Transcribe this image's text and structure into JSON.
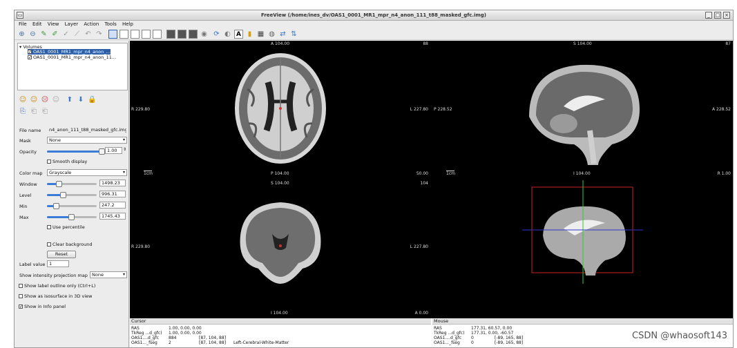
{
  "window": {
    "title": "FreeView (/home/ines_dv/OAS1_0001_MR1_mpr_n4_anon_111_t88_masked_gfc.img)",
    "controls": [
      "_",
      "□",
      "×"
    ]
  },
  "menu": [
    "File",
    "Edit",
    "View",
    "Layer",
    "Action",
    "Tools",
    "Help"
  ],
  "layers": {
    "group_label": "Volumes",
    "items": [
      {
        "label": "OAS1_0001_MR1_mpr_n4_anon_...",
        "checked": true,
        "selected": true
      },
      {
        "label": "OAS1_0001_MR1_mpr_n4_anon_11...",
        "checked": true,
        "selected": false
      }
    ]
  },
  "props": {
    "file_name_label": "File name",
    "file_name_value": "n4_anon_111_t88_masked_gfc.img",
    "mask_label": "Mask",
    "mask_value": "None",
    "opacity_label": "Opacity",
    "opacity_value": "1.00",
    "opacity_level": 1.0,
    "smooth_display": "Smooth display",
    "color_map_label": "Color map",
    "color_map_value": "Grayscale",
    "window_label": "Window",
    "window_value": "1498.23",
    "window_level": 0.25,
    "level_label": "Level",
    "level_value": "996.31",
    "level_level": 0.33,
    "min_label": "Min",
    "min_value": "247.2",
    "min_level": 0.2,
    "max_label": "Max",
    "max_value": "1745.43",
    "max_level": 0.5,
    "use_percentile": "Use percentile",
    "clear_background": "Clear background",
    "reset_button": "Reset",
    "label_value_label": "Label value",
    "label_value": "1",
    "projection_label": "Show intensity projection map",
    "projection_value": "None",
    "show_outline": "Show label outline only (Ctrl+L)",
    "show_isosurface": "Show as isosurface in 3D view",
    "show_info": "Show in Info panel"
  },
  "views": {
    "axial": {
      "top": "A 104.00",
      "left": "R 229.80",
      "right": "L 227.80",
      "bottom": "P 104.00",
      "top_right": "88",
      "bottom_right": "50.00",
      "scale": "1cm"
    },
    "sagittal": {
      "top": "S 104.00",
      "left": "P 228.52",
      "right": "A 228.52",
      "bottom": "I 104.00",
      "top_right": "87",
      "bottom_right": "R 1.00",
      "scale": "1cm"
    },
    "coronal": {
      "top": "S 104.00",
      "left": "R 229.80",
      "right": "L 227.80",
      "bottom": "I 104.00",
      "top_right": "104",
      "bottom_right": "A 0.00"
    }
  },
  "info": {
    "cursor_header": "Cursor",
    "mouse_header": "Mouse",
    "cursor_rows": [
      {
        "name": "RAS",
        "v1": "1.00, 0.00, 0.00",
        "v2": "",
        "v3": ""
      },
      {
        "name": "TkReg ...d_gfc)",
        "v1": "1.00, 0.00, 0.00",
        "v2": "",
        "v3": ""
      },
      {
        "name": "OAS1....d_gfc",
        "v1": "884",
        "v2": "[87, 104, 88]",
        "v3": ""
      },
      {
        "name": "OAS1..._fseg",
        "v1": "2",
        "v2": "[87, 104, 88]",
        "v3": "Left-Cerebral-White-Matter"
      }
    ],
    "mouse_rows": [
      {
        "name": "RAS",
        "v1": "177.31, 60.57, 0.00",
        "v2": ""
      },
      {
        "name": "TkReg ...d_gfc)",
        "v1": "177.31, 0.00, -60.57",
        "v2": ""
      },
      {
        "name": "OAS1....d_gfc",
        "v1": "0",
        "v2": "[-89, 165, 88]"
      },
      {
        "name": "OAS1..._fseg",
        "v1": "0",
        "v2": "[-89, 165, 88]"
      }
    ]
  },
  "watermark": "CSDN @whaosoft143"
}
